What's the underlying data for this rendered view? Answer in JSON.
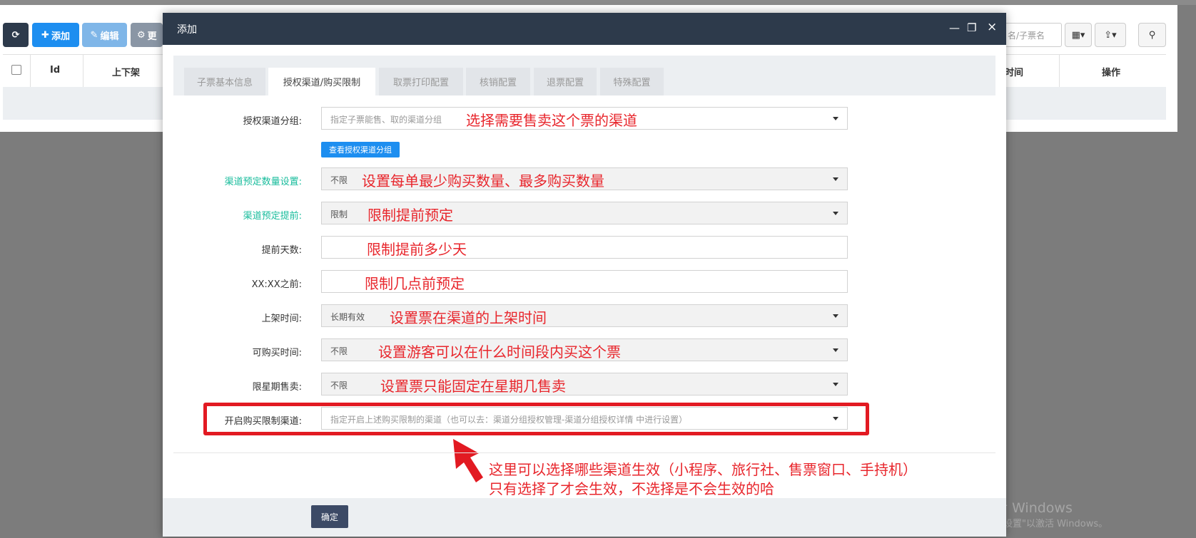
{
  "background": {
    "toolbar": {
      "add_label": "添加",
      "edit_label": "编辑",
      "more_label": "更",
      "search_placeholder": "名/子票名"
    },
    "table": {
      "columns": [
        "Id",
        "上下架",
        "时间",
        "操作"
      ]
    },
    "watermark": {
      "line1": "激活 Windows",
      "line2": "转到\"设置\"以激活 Windows。"
    }
  },
  "modal": {
    "title": "添加",
    "window_controls": [
      "—",
      "❐",
      "×"
    ],
    "tabs": [
      {
        "label": "子票基本信息",
        "active": false
      },
      {
        "label": "授权渠道/购买限制",
        "active": true
      },
      {
        "label": "取票打印配置",
        "active": false
      },
      {
        "label": "核销配置",
        "active": false
      },
      {
        "label": "退票配置",
        "active": false
      },
      {
        "label": "特殊配置",
        "active": false
      }
    ],
    "form": {
      "channel_group": {
        "label": "授权渠道分组:",
        "placeholder": "指定子票能售、取的渠道分组",
        "note": "选择需要售卖这个票的渠道",
        "view_button": "查看授权渠道分组"
      },
      "quantity": {
        "label": "渠道预定数量设置:",
        "value": "不限",
        "note": "设置每单最少购买数量、最多购买数量"
      },
      "advance": {
        "label": "渠道预定提前:",
        "value": "限制",
        "note": "限制提前预定"
      },
      "advance_days": {
        "label": "提前天数:",
        "note": "限制提前多少天"
      },
      "before_time": {
        "label": "XX:XX之前:",
        "note": "限制几点前预定"
      },
      "shelf_time": {
        "label": "上架时间:",
        "value": "长期有效",
        "note": "设置票在渠道的上架时间"
      },
      "purchase_time": {
        "label": "可购买时间:",
        "value": "不限",
        "note": "设置游客可以在什么时间段内买这个票"
      },
      "weekday": {
        "label": "限星期售卖:",
        "value": "不限",
        "note": "设置票只能固定在星期几售卖"
      },
      "limit_channel": {
        "label": "开启购买限制渠道:",
        "placeholder": "指定开启上述购买限制的渠道（也可以去：渠道分组授权管理-渠道分组授权详情 中进行设置）"
      }
    },
    "annotation": {
      "line1": "这里可以选择哪些渠道生效（小程序、旅行社、售票窗口、手持机）",
      "line2": "只有选择了才会生效，不选择是不会生效的哈"
    },
    "confirm_label": "确定"
  },
  "colors": {
    "header_bg": "#2d3a4b",
    "primary_blue": "#1d8ef0",
    "annotation_red": "#e8262c",
    "label_green": "#18bc9c"
  }
}
